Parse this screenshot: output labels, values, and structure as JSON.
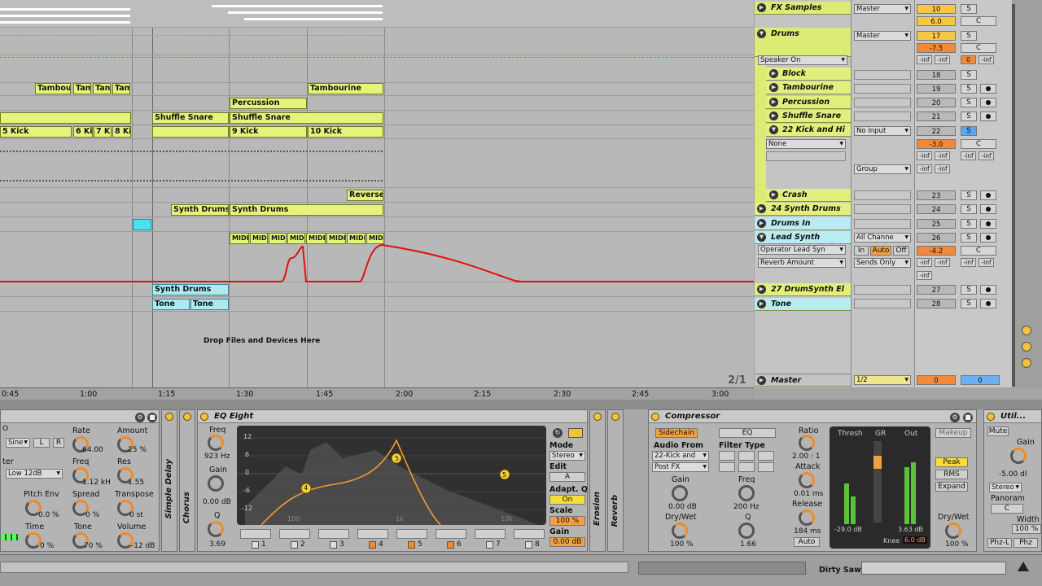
{
  "arrangement": {
    "clips": {
      "tambourine_a": "Tambour",
      "tam1": "Tam",
      "tam2": "Tan",
      "tam3": "Tam",
      "tambourine_b": "Tambourine",
      "percussion": "Percussion",
      "shuffle_a": "Shuffle Snare",
      "shuffle_b": "Shuffle Snare",
      "kick5": "5 Kick",
      "kick6": "6 Kic",
      "kick7": "7 Ki",
      "kick8": "8 Kic",
      "kick9": "9 Kick",
      "kick10": "10 Kick",
      "reverse": "Reverse C",
      "synth_a": "Synth Drums",
      "synth_b": "Synth Drums",
      "midi": "MIDI",
      "synth_c": "Synth Drums",
      "tone_a": "Tone",
      "tone_b": "Tone"
    },
    "drop_text": "Drop Files and Devices Here"
  },
  "tracks": {
    "fx_samples": "FX Samples",
    "drums": "Drums",
    "block": "Block",
    "tambourine": "Tambourine",
    "percussion": "Percussion",
    "shuffle_snare": "Shuffle Snare",
    "kick_hi": "22 Kick and Hi",
    "crash": "Crash",
    "synth_drums": "24 Synth Drums",
    "drums_in": "Drums In",
    "lead_synth": "Lead Synth",
    "drumsynth": "27 DrumSynth El",
    "tone": "Tone",
    "master": "Master"
  },
  "io": {
    "master": "Master",
    "speaker_on": "Speaker On",
    "no_input": "No Input",
    "none": "None",
    "group": "Group",
    "all_channels": "All Channe",
    "operator": "Operator Lead Syn",
    "reverb": "Reverb Amount",
    "in": "In",
    "auto": "Auto",
    "off": "Off",
    "sends_only": "Sends Only",
    "master_out": "1/2",
    "zoom": "2/1"
  },
  "mixer": {
    "fx_num": "10",
    "fx_vol": "6.0",
    "drums_num": "17",
    "drums_vol": "-7.5",
    "block_num": "18",
    "tamb_num": "19",
    "perc_num": "20",
    "shuffle_num": "21",
    "kick_num": "22",
    "kick_vol": "-3.0",
    "crash_num": "23",
    "synth_num": "24",
    "drumsin_num": "25",
    "lead_num": "26",
    "lead_vol": "-4.2",
    "drumsynth_num": "27",
    "tone_num": "28",
    "master_vol": "0",
    "master_pan": "0",
    "s": "S",
    "c": "C",
    "inf": "-inf",
    "zero": "0"
  },
  "ruler": [
    "0:45",
    "1:00",
    "1:15",
    "1:30",
    "1:45",
    "2:00",
    "2:15",
    "2:30",
    "2:45",
    "3:00"
  ],
  "devices": {
    "lfo": {
      "rate_label": "Rate",
      "rate_val": "64.00",
      "amount_label": "Amount",
      "amount_val": "25 %",
      "wave": "Sine",
      "lbtn": "L",
      "rbtn": "R",
      "filter_label": "Filter",
      "filter_val": "Low 12dB",
      "freq_label": "Freq",
      "freq_val": "1.12 kH",
      "res_label": "Res",
      "res_val": "1.55",
      "pitch_label": "Pitch Env",
      "pitch_val": "0.0 %",
      "spread_label": "Spread",
      "spread_val": "0 %",
      "transpose_label": "Transpose",
      "transpose_val": "0 st",
      "time_label": "Time",
      "time_val": "0 %",
      "tone_label": "Tone",
      "tone_val": "70 %",
      "volume_label": "Volume",
      "volume_val": "-12 dB"
    },
    "simple_delay": "Simple Delay",
    "chorus": "Chorus",
    "eq": {
      "title": "EQ Eight",
      "freq_label": "Freq",
      "freq_val": "923 Hz",
      "gain_label": "Gain",
      "gain_val": "0.00 dB",
      "q_label": "Q",
      "q_val": "3.69",
      "mode_label": "Mode",
      "mode_val": "Stereo",
      "edit_label": "Edit",
      "edit_val": "A",
      "adaptq_label": "Adapt. Q",
      "adaptq_val": "On",
      "scale_label": "Scale",
      "scale_val": "100 %",
      "gain2_label": "Gain",
      "gain2_val": "0.00 dB",
      "y_ticks": [
        "12",
        "6",
        "0",
        "-6",
        "-12"
      ],
      "x_ticks": [
        "100",
        "1k",
        "10k"
      ],
      "bands": [
        "1",
        "2",
        "3",
        "4",
        "5",
        "6",
        "7",
        "8"
      ],
      "node_a": "4",
      "node_b": "5",
      "node_c": "5"
    },
    "erosion": "Erosion",
    "reverb": "Reverb",
    "compressor": {
      "title": "Compressor",
      "sidechain": "Sidechain",
      "eq": "EQ",
      "audio_from_label": "Audio From",
      "audio_from_val": "22-Kick and",
      "post_fx": "Post FX",
      "filter_type": "Filter Type",
      "gain_label": "Gain",
      "gain_val": "0.00 dB",
      "drywet_label": "Dry/Wet",
      "drywet_val": "100 %",
      "freq_label": "Freq",
      "freq_val": "200 Hz",
      "q_label": "Q",
      "q_val": "1.66",
      "ratio_label": "Ratio",
      "ratio_val": "2.00 : 1",
      "attack_label": "Attack",
      "attack_val": "0.01 ms",
      "release_label": "Release",
      "release_val": "184 ms",
      "auto": "Auto",
      "thresh_label": "Thresh",
      "gr_label": "GR",
      "out_label": "Out",
      "thresh_val": "-29.0 dB",
      "out_val": "3.63 dB",
      "knee_label": "Knee",
      "knee_val": "6.0 dB",
      "makeup": "Makeup",
      "peak": "Peak",
      "rms": "RMS",
      "expand": "Expand",
      "drywet2_label": "Dry/Wet",
      "drywet2_val": "100 %"
    },
    "utility": {
      "title": "Util...",
      "mute": "Mute",
      "gain_label": "Gain",
      "gain_val": "-5.00 dl",
      "stereo": "Stereo",
      "panorama_label": "Panoram",
      "pan_val": "C",
      "width_label": "Width",
      "width_val": "100 %",
      "phz": "Phz-L",
      "phzr": "Phz"
    }
  },
  "statusbar": {
    "clip_name": "Dirty Saw"
  }
}
